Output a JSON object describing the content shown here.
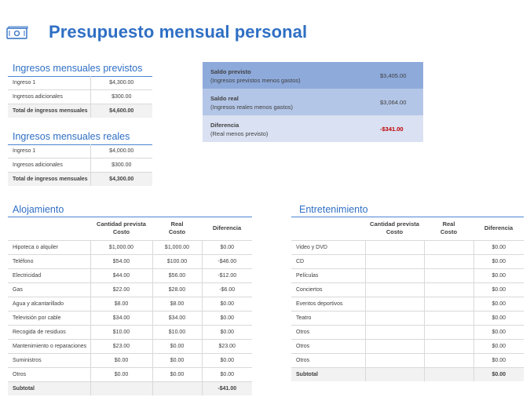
{
  "title": "Presupuesto mensual personal",
  "colors": {
    "accent": "#2f6fc4",
    "balance_dark": "#8eaadb",
    "balance_mid": "#b4c6e7",
    "balance_light": "#d9e1f2",
    "negative": "#c00000"
  },
  "icons": {
    "logo": "money-icon"
  },
  "planned_income": {
    "heading": "Ingresos mensuales previstos",
    "rows": [
      {
        "label": "Ingreso 1",
        "value": "$4,300.00"
      },
      {
        "label": "Ingresos adicionales",
        "value": "$300.00"
      }
    ],
    "total": {
      "label": "Total de ingresos mensuales",
      "value": "$4,600.00"
    }
  },
  "actual_income": {
    "heading": "Ingresos mensuales reales",
    "rows": [
      {
        "label": "Ingreso 1",
        "value": "$4,000.00"
      },
      {
        "label": "Ingresos adicionales",
        "value": "$300.00"
      }
    ],
    "total": {
      "label": "Total de ingresos mensuales",
      "value": "$4,300.00"
    }
  },
  "balance": [
    {
      "label": "Saldo previsto",
      "sub": "(Ingresos previstos menos gastos)",
      "value": "$3,405.00"
    },
    {
      "label": "Saldo real",
      "sub": "(Ingresos reales menos gastos)",
      "value": "$3,064.00"
    },
    {
      "label": "Diferencia",
      "sub": "(Real menos previsto)",
      "value": "-$341.00"
    }
  ],
  "headers": {
    "planned_1": "Cantidad prevista",
    "planned_2": "Costo",
    "actual_1": "Real",
    "actual_2": "Costo",
    "diff": "Diferencia"
  },
  "housing": {
    "heading": "Alojamiento",
    "rows": [
      {
        "label": "Hipoteca o alquiler",
        "planned": "$1,000.00",
        "actual": "$1,000.00",
        "diff": "$0.00"
      },
      {
        "label": "Teléfono",
        "planned": "$54.00",
        "actual": "$100.00",
        "diff": "-$46.00"
      },
      {
        "label": "Electricidad",
        "planned": "$44.00",
        "actual": "$56.00",
        "diff": "-$12.00"
      },
      {
        "label": "Gas",
        "planned": "$22.00",
        "actual": "$28.00",
        "diff": "-$6.00"
      },
      {
        "label": "Agua y alcantarillado",
        "planned": "$8.00",
        "actual": "$8.00",
        "diff": "$0.00"
      },
      {
        "label": "Televisión por cable",
        "planned": "$34.00",
        "actual": "$34.00",
        "diff": "$0.00"
      },
      {
        "label": "Recogida de residuos",
        "planned": "$10.00",
        "actual": "$10.00",
        "diff": "$0.00"
      },
      {
        "label": "Mantenimiento o reparaciones",
        "planned": "$23.00",
        "actual": "$0.00",
        "diff": "$23.00"
      },
      {
        "label": "Suministros",
        "planned": "$0.00",
        "actual": "$0.00",
        "diff": "$0.00"
      },
      {
        "label": "Otros",
        "planned": "$0.00",
        "actual": "$0.00",
        "diff": "$0.00"
      }
    ],
    "subtotal": {
      "label": "Subtotal",
      "planned": "",
      "actual": "",
      "diff": "-$41.00"
    }
  },
  "entertainment": {
    "heading": "Entretenimiento",
    "rows": [
      {
        "label": "Video y DVD",
        "planned": "",
        "actual": "",
        "diff": "$0.00"
      },
      {
        "label": "CD",
        "planned": "",
        "actual": "",
        "diff": "$0.00"
      },
      {
        "label": "Películas",
        "planned": "",
        "actual": "",
        "diff": "$0.00"
      },
      {
        "label": "Conciertos",
        "planned": "",
        "actual": "",
        "diff": "$0.00"
      },
      {
        "label": "Eventos deportivos",
        "planned": "",
        "actual": "",
        "diff": "$0.00"
      },
      {
        "label": "Teatro",
        "planned": "",
        "actual": "",
        "diff": "$0.00"
      },
      {
        "label": "Otros",
        "planned": "",
        "actual": "",
        "diff": "$0.00"
      },
      {
        "label": "Otros",
        "planned": "",
        "actual": "",
        "diff": "$0.00"
      },
      {
        "label": "Otros",
        "planned": "",
        "actual": "",
        "diff": "$0.00"
      }
    ],
    "subtotal": {
      "label": "Subtotal",
      "planned": "",
      "actual": "",
      "diff": "$0.00"
    }
  }
}
